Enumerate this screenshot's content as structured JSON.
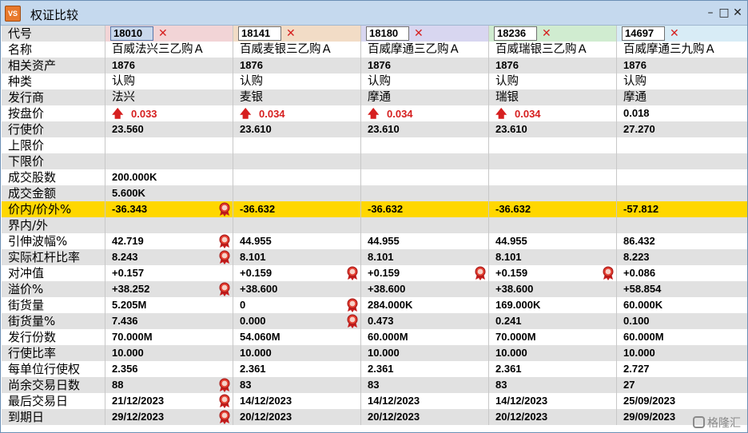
{
  "window": {
    "title": "权证比较",
    "app_icon": "VS"
  },
  "codes": [
    "18010",
    "18141",
    "18180",
    "18236",
    "14697"
  ],
  "header_colors": [
    "#f2d4d6",
    "#f2dcc6",
    "#d8d6f0",
    "#d0ecd0",
    "#d8ecf6"
  ],
  "rows": [
    {
      "label": "名称",
      "type": "text",
      "values": [
        "百威法兴三乙购Ａ",
        "百威麦银三乙购Ａ",
        "百威摩通三乙购Ａ",
        "百威瑞银三乙购Ａ",
        "百威摩通三九购Ａ"
      ]
    },
    {
      "label": "相关资产",
      "values": [
        "1876",
        "1876",
        "1876",
        "1876",
        "1876"
      ]
    },
    {
      "label": "种类",
      "type": "text",
      "values": [
        "认购",
        "认购",
        "认购",
        "认购",
        "认购"
      ]
    },
    {
      "label": "发行商",
      "type": "text",
      "values": [
        "法兴",
        "麦银",
        "摩通",
        "瑞银",
        "摩通"
      ]
    },
    {
      "label": "按盘价",
      "values": [
        "0.033",
        "0.034",
        "0.034",
        "0.034",
        "0.018"
      ],
      "up": [
        true,
        true,
        true,
        true,
        false
      ]
    },
    {
      "label": "行使价",
      "values": [
        "23.560",
        "23.610",
        "23.610",
        "23.610",
        "27.270"
      ]
    },
    {
      "label": "上限价",
      "values": [
        "",
        "",
        "",
        "",
        ""
      ]
    },
    {
      "label": "下限价",
      "values": [
        "",
        "",
        "",
        "",
        ""
      ]
    },
    {
      "label": "成交股数",
      "values": [
        "200.000K",
        "",
        "",
        "",
        ""
      ]
    },
    {
      "label": "成交金额",
      "values": [
        "5.600K",
        "",
        "",
        "",
        ""
      ]
    },
    {
      "label": "价内/价外%",
      "values": [
        "-36.343",
        "-36.632",
        "-36.632",
        "-36.632",
        "-57.812"
      ],
      "medal": [
        true,
        false,
        false,
        false,
        false
      ],
      "highlight": true
    },
    {
      "label": "界内/外",
      "values": [
        "",
        "",
        "",
        "",
        ""
      ]
    },
    {
      "label": "引伸波幅%",
      "values": [
        "42.719",
        "44.955",
        "44.955",
        "44.955",
        "86.432"
      ],
      "medal": [
        true,
        false,
        false,
        false,
        false
      ]
    },
    {
      "label": "实际杠杆比率",
      "values": [
        "8.243",
        "8.101",
        "8.101",
        "8.101",
        "8.223"
      ],
      "medal": [
        true,
        false,
        false,
        false,
        false
      ]
    },
    {
      "label": "对冲值",
      "values": [
        "+0.157",
        "+0.159",
        "+0.159",
        "+0.159",
        "+0.086"
      ],
      "medal": [
        false,
        true,
        true,
        true,
        false
      ]
    },
    {
      "label": "溢价%",
      "values": [
        "+38.252",
        "+38.600",
        "+38.600",
        "+38.600",
        "+58.854"
      ],
      "medal": [
        true,
        false,
        false,
        false,
        false
      ]
    },
    {
      "label": "街货量",
      "values": [
        "5.205M",
        "0",
        "284.000K",
        "169.000K",
        "60.000K"
      ],
      "medal": [
        false,
        true,
        false,
        false,
        false
      ]
    },
    {
      "label": "街货量%",
      "values": [
        "7.436",
        "0.000",
        "0.473",
        "0.241",
        "0.100"
      ],
      "medal": [
        false,
        true,
        false,
        false,
        false
      ]
    },
    {
      "label": "发行份数",
      "values": [
        "70.000M",
        "54.060M",
        "60.000M",
        "70.000M",
        "60.000M"
      ]
    },
    {
      "label": "行使比率",
      "values": [
        "10.000",
        "10.000",
        "10.000",
        "10.000",
        "10.000"
      ]
    },
    {
      "label": "每单位行使权",
      "values": [
        "2.356",
        "2.361",
        "2.361",
        "2.361",
        "2.727"
      ]
    },
    {
      "label": "尚余交易日数",
      "values": [
        "88",
        "83",
        "83",
        "83",
        "27"
      ],
      "medal": [
        true,
        false,
        false,
        false,
        false
      ]
    },
    {
      "label": "最后交易日",
      "values": [
        "21/12/2023",
        "14/12/2023",
        "14/12/2023",
        "14/12/2023",
        "25/09/2023"
      ],
      "medal": [
        true,
        false,
        false,
        false,
        false
      ]
    },
    {
      "label": "到期日",
      "values": [
        "29/12/2023",
        "20/12/2023",
        "20/12/2023",
        "20/12/2023",
        "29/09/2023"
      ],
      "medal": [
        true,
        false,
        false,
        false,
        false
      ]
    }
  ],
  "header_label": "代号",
  "watermark": "格隆汇"
}
